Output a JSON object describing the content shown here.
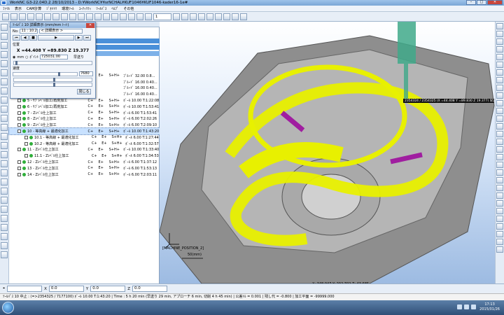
{
  "window": {
    "title": "WorkNC G3-22.04D.2     28/10/2013 - D:¥WorkNC¥¥srNCHAL¥KUF1046¥KUF1046-kader16-1e#"
  },
  "menu": [
    "ﾌｧｲﾙ",
    "表示",
    "CAM計算",
    "ｼﾞｵﾒﾄﾘ",
    "環境ﾂｰﾙ",
    "ﾕｰﾃｨﾘﾃｨ",
    "ﾂｰﾙﾊﾟｽ",
    "ﾍﾙﾌﾟ",
    "その他"
  ],
  "toolbar": {
    "select_value": "1"
  },
  "tree": {
    "rows": [
      {
        "name": "",
        "a": "C+",
        "b": "E+",
        "c": "S+H+",
        "d": "ﾌﾞﾙｰﾄﾞ 32.00 0.8..."
      },
      {
        "name": "",
        "a": "",
        "b": "",
        "c": "",
        "d": "ﾌﾞﾙｰﾄﾞ 16.00 0.40..."
      },
      {
        "name": "",
        "a": "",
        "b": "",
        "c": "",
        "d": "ﾌﾞﾙｰﾄﾞ 16.00 0.40..."
      },
      {
        "name": "",
        "a": "",
        "b": "",
        "c": "",
        "d": "ﾌﾞﾙｰﾄﾞ 16.00 0.40..."
      },
      {
        "name": "5 - ｻﾌﾞﾚﾍﾞﾙ加工/再荒加工",
        "a": "C+",
        "b": "E+",
        "c": "S+H+",
        "d": "ﾎﾞｰﾙ 10.00 T:1:22:08"
      },
      {
        "name": "6 - ｻﾌﾞﾚﾍﾞﾙ加工/再荒加工",
        "a": "C+",
        "b": "E+",
        "c": "S+H+",
        "d": "ﾎﾞｰﾙ 10.00 T:1:53:41"
      },
      {
        "name": "7 - Zﾚﾍﾞﾙ仕上加工",
        "a": "C+",
        "b": "E+",
        "c": "S+H+",
        "d": "ﾎﾞｰﾙ 6.00 T:1:53:41"
      },
      {
        "name": "8 - Zﾚﾍﾞﾙ仕上加工",
        "a": "C+",
        "b": "E+",
        "c": "S+H+",
        "d": "ﾎﾞｰﾙ 6.00 T:2:02:26"
      },
      {
        "name": "9 - Zﾚﾍﾞﾙ仕上加工",
        "a": "C+",
        "b": "E+",
        "c": "S+H+",
        "d": "ﾎﾞｰﾙ 6.00 T:2:09:10"
      },
      {
        "name": "10 - 等高線 + 最適化加工",
        "a": "C+",
        "b": "E+",
        "c": "S+H+",
        "d": "ﾎﾞｰﾙ 10.00 T:1:43:20",
        "selected": true
      },
      {
        "name": "10.1 - 等高線 + 最適化加工",
        "a": "C+",
        "b": "E+",
        "c": "S+H+",
        "d": "ﾎﾞｰﾙ 6.00 T:1:27:44"
      },
      {
        "name": "10.2 - 等高線 + 最適化加工",
        "a": "C+",
        "b": "E+",
        "c": "S+H+",
        "d": "ﾎﾞｰﾙ 6.00 T:1:32:57"
      },
      {
        "name": "11 - Zﾚﾍﾞﾙ仕上加工",
        "a": "C+",
        "b": "E+",
        "c": "S+H+",
        "d": "ﾎﾞｰﾙ 10.00 T:1:33:40"
      },
      {
        "name": "11.1 - Zﾚﾍﾞﾙ仕上加工",
        "a": "C+",
        "b": "E+",
        "c": "S+H+",
        "d": "ﾎﾞｰﾙ 6.00 T:1:34:53"
      },
      {
        "name": "12 - Zﾚﾍﾞﾙ仕上加工",
        "a": "C+",
        "b": "E+",
        "c": "S+H+",
        "d": "ﾎﾞｰﾙ 6.00 T:1:37:12"
      },
      {
        "name": "13 - Zﾚﾍﾞﾙ仕上加工",
        "a": "C+",
        "b": "E+",
        "c": "S+H+",
        "d": "ﾎﾞｰﾙ 6.00 T:1:53:13"
      },
      {
        "name": "14 - Zﾚﾍﾞﾙ仕上加工",
        "a": "C+",
        "b": "E+",
        "c": "S+H+",
        "d": "ﾎﾞｰﾙ 6.00 T:2:03:11"
      }
    ]
  },
  "dialog": {
    "title": "ﾂｰﾙﾊﾟｽ 10 詳細表示 (mm/mm ﾄｰﾄ)",
    "toolpath_label": "No:",
    "toolpath_value": "11 : 10.2",
    "detail_label": "< 詳細表示 >",
    "position_label": "位置",
    "coordinates": "X =44.408 Y =89.830 Z 19.377",
    "mm_label": "mm",
    "point_label": "ﾎﾟｲﾝﾄ",
    "point_value": "725031.00",
    "forward_label": "早送り",
    "speed_label": "速度",
    "speed_value": "7680",
    "close_label": "閉じる",
    "speed_fraction": 0.8
  },
  "viewport": {
    "origin_label": "[MACHINE_POSITION_2]",
    "scale_label": "50(mm)",
    "tooltip": "2354324 / 2354325 (X =44.408 Y =89.830 Z 19.377) 早送り",
    "coords": "X: 348.947     Y: 202.702     Z: 43.685"
  },
  "bottombar": {
    "x_label": "X",
    "x_value": "0.0",
    "y_label": "Y",
    "y_value": "0.0",
    "z_label": "Z",
    "z_value": "0.0"
  },
  "status": "ﾂｰﾙﾊﾟｽ 10   中止 : (=>2354325 / 7177100)  ﾎﾞｰﾙ 10.00 T:1:43:20 | Time : 5 h 20 min (早送り 29 min, アプローチ 6 min, 切削 4 h 45 min) | 公差ﾄﾙ = 0.001 | 残し代 = -0.800 | 加工平面 = -99999.000",
  "clock": {
    "time": "17:13",
    "date": "2015/01/26"
  }
}
